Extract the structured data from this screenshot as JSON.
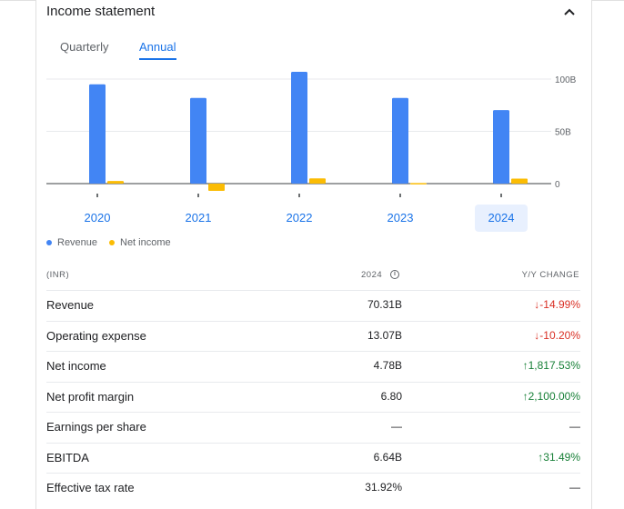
{
  "card": {
    "title": "Income statement",
    "tabs": [
      {
        "label": "Quarterly",
        "selected": false
      },
      {
        "label": "Annual",
        "selected": true
      }
    ]
  },
  "chart_data": {
    "type": "bar",
    "categories": [
      "2020",
      "2021",
      "2022",
      "2023",
      "2024"
    ],
    "selected_category": "2024",
    "series": [
      {
        "name": "Revenue",
        "color": "#4285f4",
        "values": [
          95,
          82,
          107,
          82,
          70.31
        ]
      },
      {
        "name": "Net income",
        "color": "#fbbc04",
        "values": [
          2.5,
          -7,
          5,
          0.5,
          4.78
        ]
      }
    ],
    "y_ticks": [
      {
        "value": 100,
        "label": "100B"
      },
      {
        "value": 50,
        "label": "50B"
      },
      {
        "value": 0,
        "label": "0"
      }
    ],
    "ylim": [
      -10,
      110
    ],
    "unit": "B",
    "grid": true,
    "legend_position": "bottom-left"
  },
  "table": {
    "columns": [
      "(INR)",
      "2024",
      "Y/Y CHANGE"
    ],
    "rows": [
      {
        "label": "Revenue",
        "value": "70.31B",
        "change": "-14.99%",
        "direction": "down"
      },
      {
        "label": "Operating expense",
        "value": "13.07B",
        "change": "-10.20%",
        "direction": "down"
      },
      {
        "label": "Net income",
        "value": "4.78B",
        "change": "1,817.53%",
        "direction": "up"
      },
      {
        "label": "Net profit margin",
        "value": "6.80",
        "change": "2,100.00%",
        "direction": "up"
      },
      {
        "label": "Earnings per share",
        "value": "—",
        "change": "—",
        "direction": "none"
      },
      {
        "label": "EBITDA",
        "value": "6.64B",
        "change": "31.49%",
        "direction": "up"
      },
      {
        "label": "Effective tax rate",
        "value": "31.92%",
        "change": "—",
        "direction": "none"
      }
    ]
  },
  "icons": {
    "collapse": "chevron-up-icon",
    "info": "info-icon",
    "down": "arrow-down-icon",
    "up": "arrow-up-icon"
  }
}
